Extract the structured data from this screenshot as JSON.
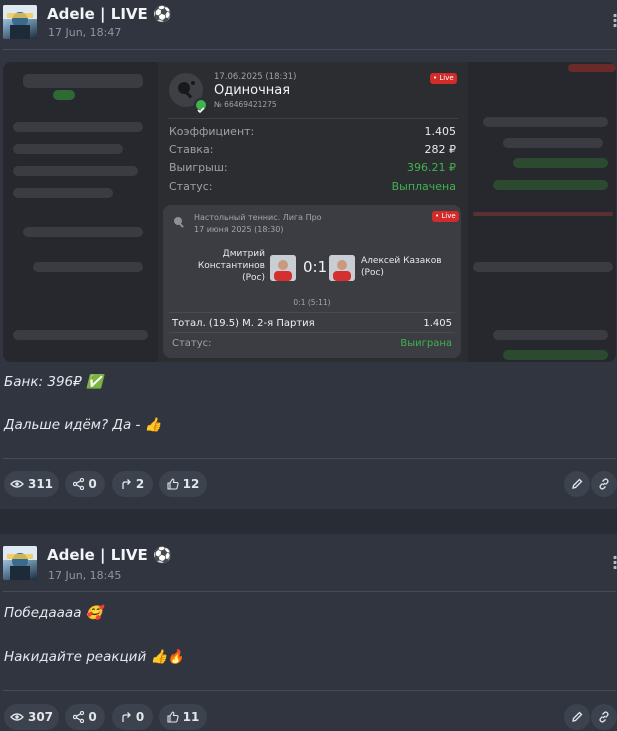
{
  "posts": [
    {
      "author": "Adele | LIVE ⚽",
      "date": "17 Jun, 18:47",
      "bet": {
        "datetime": "17.06.2025 (18:31)",
        "type": "Одиночная",
        "number": "№ 66469421275",
        "live_badge": "• Live",
        "coef_label": "Коэффициент:",
        "coef_value": "1.405",
        "stake_label": "Ставка:",
        "stake_value": "282 ₽",
        "win_label": "Выигрыш:",
        "win_value": "396.21 ₽",
        "status_label": "Статус:",
        "status_value": "Выплачена",
        "event": {
          "league": "Настольный теннис. Лига Про",
          "date": "17 июня 2025 (18:30)",
          "live_badge": "• Live",
          "player1_line1": "Дмитрий",
          "player1_line2": "Константинов",
          "player1_line3": "(Рос)",
          "score": "0:1",
          "player2_line1": "Алексей Казаков",
          "player2_line2": "(Рос)",
          "set_score": "0:1 (5:11)",
          "market": "Тотал. (19.5) М. 2-я Партия",
          "market_coef": "1.405",
          "status_label": "Статус:",
          "status_value": "Выиграна"
        }
      },
      "lines": [
        "Банк: 396₽ ✅",
        "Дальше идём? Да - 👍"
      ],
      "stats": {
        "views": "311",
        "shares": "0",
        "forwards": "2",
        "likes": "12"
      }
    },
    {
      "author": "Adele | LIVE ⚽",
      "date": "17 Jun, 18:45",
      "lines": [
        "Победаааа 🥰",
        "Накидайте реакций 👍🔥"
      ],
      "stats": {
        "views": "307",
        "shares": "0",
        "forwards": "0",
        "likes": "11"
      }
    }
  ],
  "colors": {
    "background": "#303540",
    "pill": "#3c424e",
    "win_green": "#3fb34f",
    "live_red": "#d32a2a"
  },
  "icons": [
    "eye-icon",
    "share-icon",
    "forward-icon",
    "thumbs-up-icon",
    "pencil-icon",
    "link-icon",
    "ping-pong-icon",
    "check-badge-icon",
    "kebab-menu-icon"
  ]
}
